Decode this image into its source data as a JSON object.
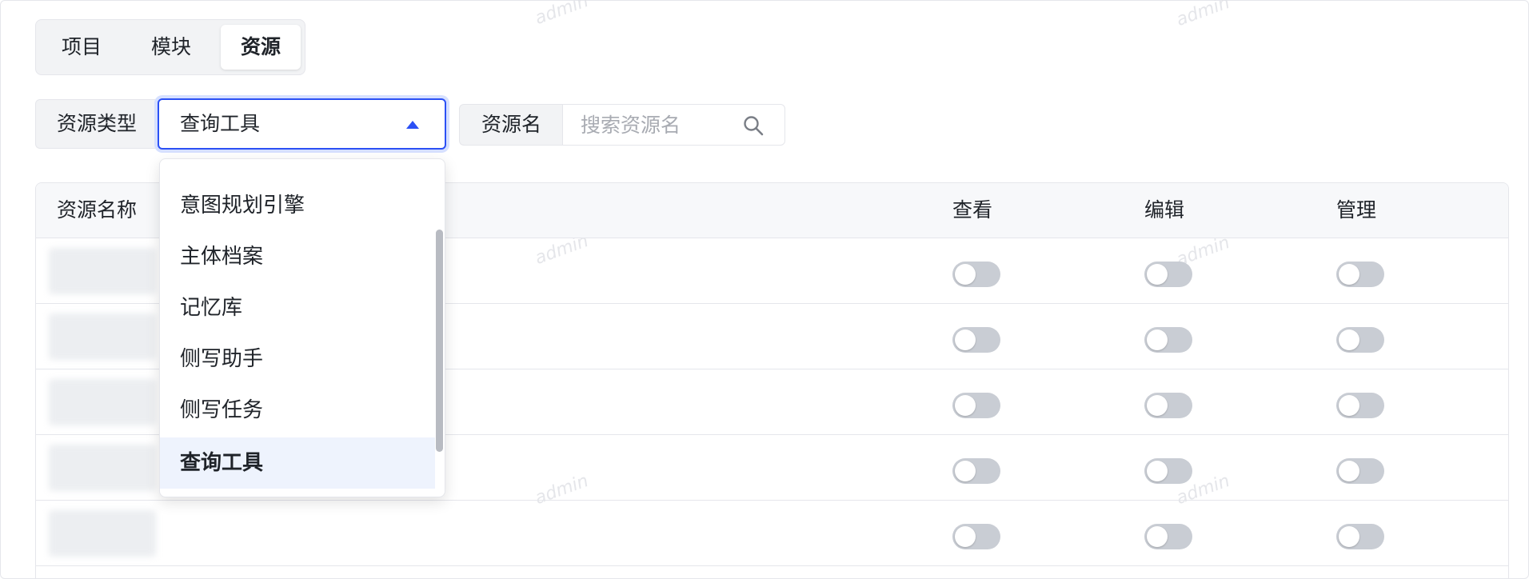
{
  "tabs": [
    "项目",
    "模块",
    "资源"
  ],
  "active_tab": "资源",
  "filter": {
    "type_label": "资源类型",
    "type_value": "查询工具",
    "name_label": "资源名",
    "name_placeholder": "搜索资源名",
    "name_value": ""
  },
  "dropdown": {
    "options": [
      "意图规划引擎",
      "主体档案",
      "记忆库",
      "侧写助手",
      "侧写任务",
      "查询工具"
    ],
    "selected": "查询工具"
  },
  "table": {
    "headers": {
      "name": "资源名称",
      "view": "查看",
      "edit": "编辑",
      "manage": "管理"
    },
    "rows": [
      {
        "view": false,
        "edit": false,
        "manage": false
      },
      {
        "view": false,
        "edit": false,
        "manage": false
      },
      {
        "view": false,
        "edit": false,
        "manage": false
      },
      {
        "view": false,
        "edit": false,
        "manage": false
      },
      {
        "view": false,
        "edit": false,
        "manage": false
      }
    ]
  },
  "watermark": "admin",
  "colors": {
    "accent": "#2b50f5",
    "toggle_off": "#c9cdd4",
    "selected_option_bg": "#eef3fd"
  }
}
